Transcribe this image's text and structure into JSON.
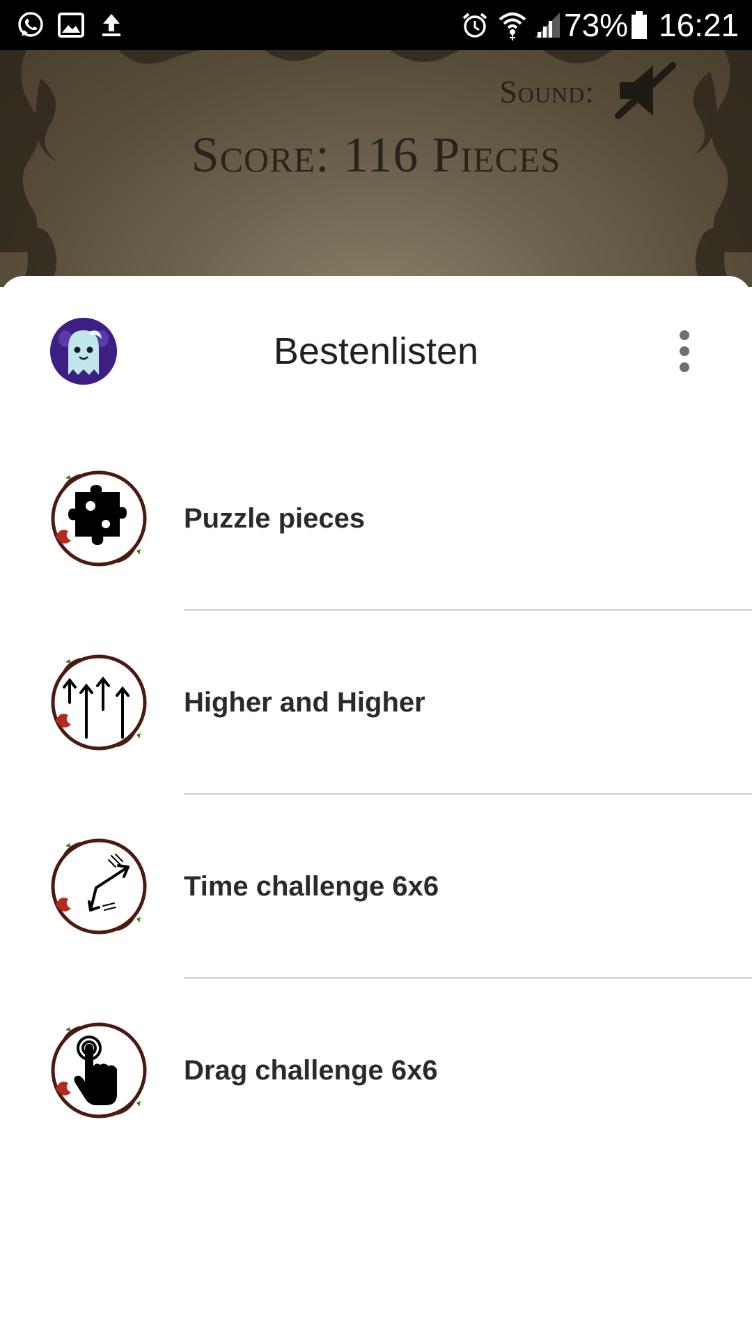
{
  "status_bar": {
    "battery": "73%",
    "time": "16:21"
  },
  "game": {
    "sound_label": "Sound:",
    "score_title": "Score: 116 Pieces"
  },
  "sheet": {
    "title": "Bestenlisten",
    "items": [
      {
        "label": "Puzzle pieces",
        "icon": "puzzle-piece-icon"
      },
      {
        "label": "Higher and Higher",
        "icon": "up-arrows-icon"
      },
      {
        "label": "Time challenge 6x6",
        "icon": "zigzag-arrow-icon"
      },
      {
        "label": "Drag challenge 6x6",
        "icon": "tap-hand-icon"
      }
    ]
  },
  "colors": {
    "status_bar_bg": "#000000",
    "sheet_bg": "#ffffff",
    "avatar_bg": "#3d1f84",
    "badge_ring": "#4a1a10",
    "divider": "#dcdcdc"
  }
}
